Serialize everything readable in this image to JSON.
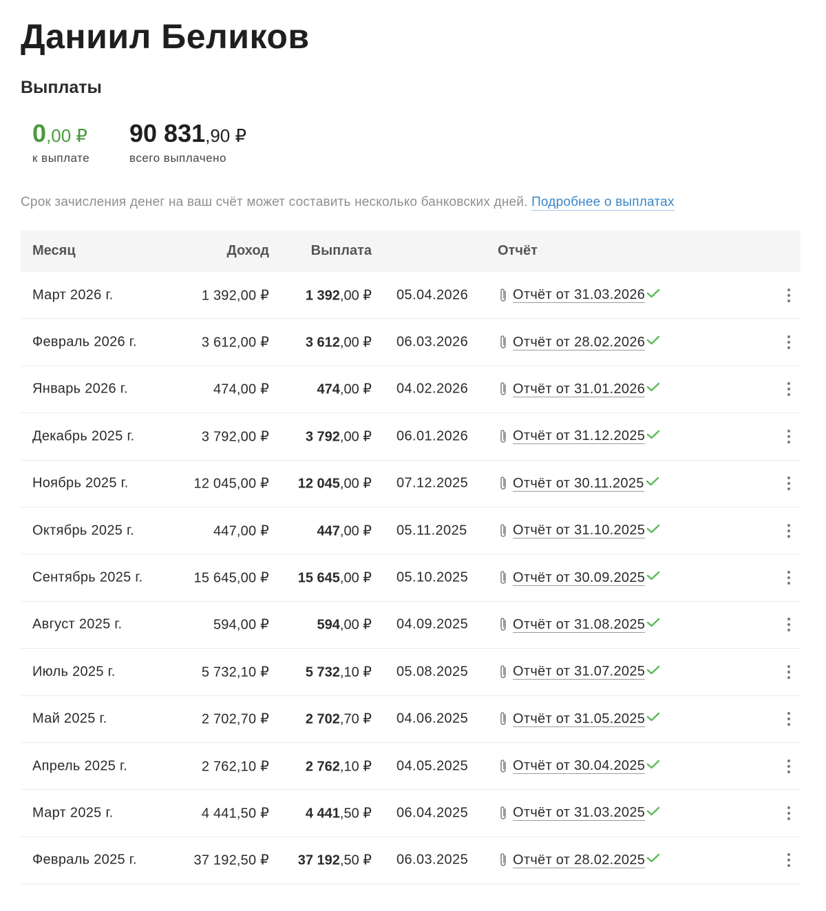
{
  "profile": {
    "name": "Даниил Беликов"
  },
  "payouts": {
    "title": "Выплаты",
    "due": {
      "int": "0",
      "frac": ",00 ₽",
      "label": "к выплате"
    },
    "total": {
      "int": "90 831",
      "frac": ",90 ₽",
      "label": "всего выплачено"
    },
    "notice": "Срок зачисления денег на ваш счёт может составить несколько банковских дней.",
    "notice_link": "Подробнее о выплатах"
  },
  "colors": {
    "due_amount": "#4a9a3c",
    "link": "#3a86c8",
    "check": "#5dbb5a",
    "header_bg": "#f5f5f5"
  },
  "table": {
    "headers": {
      "month": "Месяц",
      "income": "Доход",
      "payout": "Выплата",
      "report": "Отчёт"
    },
    "rows": [
      {
        "month": "Март 2026 г.",
        "income": "1 392,00 ₽",
        "payout_int": "1 392",
        "payout_frac": ",00 ₽",
        "date": "05.04.2026",
        "report": "Отчёт от 31.03.2026"
      },
      {
        "month": "Февраль 2026 г.",
        "income": "3 612,00 ₽",
        "payout_int": "3 612",
        "payout_frac": ",00 ₽",
        "date": "06.03.2026",
        "report": "Отчёт от 28.02.2026"
      },
      {
        "month": "Январь 2026 г.",
        "income": "474,00 ₽",
        "payout_int": "474",
        "payout_frac": ",00 ₽",
        "date": "04.02.2026",
        "report": "Отчёт от 31.01.2026"
      },
      {
        "month": "Декабрь 2025 г.",
        "income": "3 792,00 ₽",
        "payout_int": "3 792",
        "payout_frac": ",00 ₽",
        "date": "06.01.2026",
        "report": "Отчёт от 31.12.2025"
      },
      {
        "month": "Ноябрь 2025 г.",
        "income": "12 045,00 ₽",
        "payout_int": "12 045",
        "payout_frac": ",00 ₽",
        "date": "07.12.2025",
        "report": "Отчёт от 30.11.2025"
      },
      {
        "month": "Октябрь 2025 г.",
        "income": "447,00 ₽",
        "payout_int": "447",
        "payout_frac": ",00 ₽",
        "date": "05.11.2025",
        "report": "Отчёт от 31.10.2025"
      },
      {
        "month": "Сентябрь 2025 г.",
        "income": "15 645,00 ₽",
        "payout_int": "15 645",
        "payout_frac": ",00 ₽",
        "date": "05.10.2025",
        "report": "Отчёт от 30.09.2025"
      },
      {
        "month": "Август 2025 г.",
        "income": "594,00 ₽",
        "payout_int": "594",
        "payout_frac": ",00 ₽",
        "date": "04.09.2025",
        "report": "Отчёт от 31.08.2025"
      },
      {
        "month": "Июль 2025 г.",
        "income": "5 732,10 ₽",
        "payout_int": "5 732",
        "payout_frac": ",10 ₽",
        "date": "05.08.2025",
        "report": "Отчёт от 31.07.2025"
      },
      {
        "month": "Май 2025 г.",
        "income": "2 702,70 ₽",
        "payout_int": "2 702",
        "payout_frac": ",70 ₽",
        "date": "04.06.2025",
        "report": "Отчёт от 31.05.2025"
      },
      {
        "month": "Апрель 2025 г.",
        "income": "2 762,10 ₽",
        "payout_int": "2 762",
        "payout_frac": ",10 ₽",
        "date": "04.05.2025",
        "report": "Отчёт от 30.04.2025"
      },
      {
        "month": "Март 2025 г.",
        "income": "4 441,50 ₽",
        "payout_int": "4 441",
        "payout_frac": ",50 ₽",
        "date": "06.04.2025",
        "report": "Отчёт от 31.03.2025"
      },
      {
        "month": "Февраль 2025 г.",
        "income": "37 192,50 ₽",
        "payout_int": "37 192",
        "payout_frac": ",50 ₽",
        "date": "06.03.2025",
        "report": "Отчёт от 28.02.2025"
      }
    ]
  }
}
